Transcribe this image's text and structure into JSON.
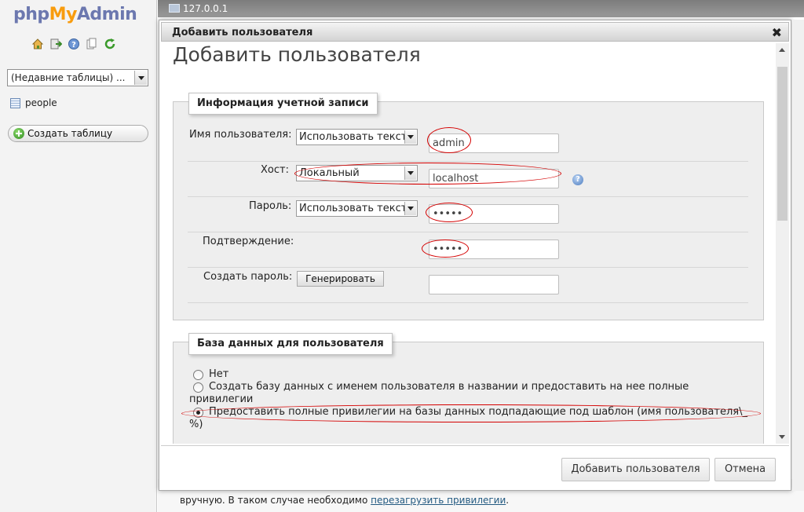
{
  "logo": {
    "part1": "php",
    "part2": "My",
    "part3": "Admin"
  },
  "nav": {
    "icons": [
      "home-icon",
      "exit-icon",
      "help-icon",
      "docs-icon",
      "reload-icon"
    ],
    "recent_tables_select": "(Недавние таблицы) ...",
    "tables": [
      {
        "name": "people"
      }
    ],
    "create_table_label": "Создать таблицу"
  },
  "server_bar": {
    "label": "127.0.0.1"
  },
  "dialog": {
    "title": "Добавить пользователя",
    "close_glyph": "✖",
    "heading": "Добавить пользователя",
    "account_section": {
      "legend": "Информация учетной записи",
      "username": {
        "label": "Имя пользователя:",
        "mode": "Использовать текст",
        "value": "admin"
      },
      "host": {
        "label": "Хост:",
        "mode": "Локальный",
        "value": "localhost"
      },
      "password": {
        "label": "Пароль:",
        "mode": "Использовать текст",
        "value": "•••••"
      },
      "confirm": {
        "label": "Подтверждение:",
        "value": "•••••"
      },
      "generate": {
        "label": "Создать пароль:",
        "button": "Генерировать",
        "value": ""
      }
    },
    "database_section": {
      "legend": "База данных для пользователя",
      "options": [
        {
          "text": "Нет",
          "selected": false
        },
        {
          "text": "Создать базу данных с именем пользователя в названии и предоставить на нее полные",
          "text2": "привилегии",
          "selected": false
        },
        {
          "text": "Предоставить полные привилегии на базы данных подпадающие под шаблон (имя пользователя\\_",
          "text2": "%)",
          "selected": true
        }
      ]
    },
    "buttons": {
      "add": "Добавить пользователя",
      "cancel": "Отмена"
    }
  },
  "bottom_note": {
    "line2_prefix": "вручную. В таком случае необходимо ",
    "link": "перезагрузить привилегии",
    "line2_suffix": "."
  },
  "colors": {
    "annotation": "#d40000",
    "logo_blue": "#6c78af",
    "logo_orange": "#f89c0e"
  }
}
